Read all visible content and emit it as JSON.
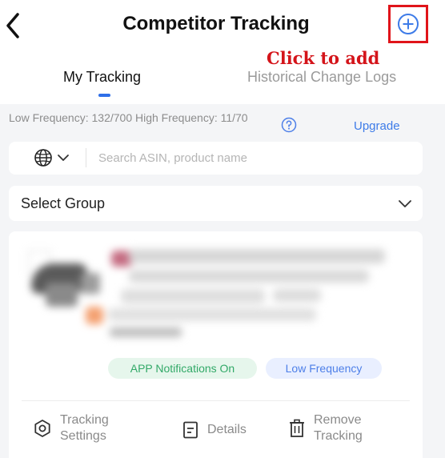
{
  "header": {
    "title": "Competitor Tracking"
  },
  "annotation": "Click to add",
  "tabs": [
    {
      "label": "My Tracking",
      "active": true
    },
    {
      "label": "Historical Change Logs",
      "active": false
    }
  ],
  "frequency": {
    "text": "Low Frequency: 132/700 High Frequency: 11/70",
    "upgrade_label": "Upgrade"
  },
  "search": {
    "placeholder": "Search ASIN, product name",
    "value": ""
  },
  "group_select": {
    "label": "Select Group"
  },
  "card": {
    "badges": [
      "APP Notifications On",
      "Low Frequency"
    ],
    "actions": {
      "settings": "Tracking Settings",
      "details": "Details",
      "remove": "Remove Tracking"
    }
  },
  "colors": {
    "accent": "#2f6fe8",
    "annotation_red": "#d4141a",
    "badge_green_text": "#32a968",
    "badge_blue_text": "#4d7fe8"
  },
  "icons": [
    "back-arrow-icon",
    "plus-circle-icon",
    "help-circle-icon",
    "globe-icon",
    "chevron-down-icon",
    "settings-hexagon-icon",
    "document-icon",
    "trash-icon"
  ]
}
